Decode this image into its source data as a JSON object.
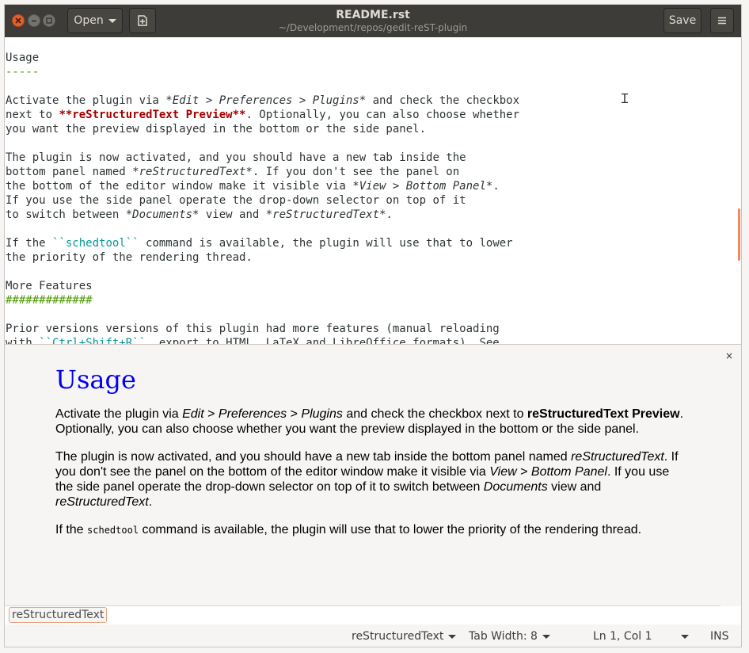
{
  "header": {
    "title": "README.rst",
    "subtitle": "~/Development/repos/gedit-reST-plugin",
    "open_label": "Open",
    "save_label": "Save"
  },
  "editor": {
    "lines": [
      [
        {
          "t": "Usage"
        }
      ],
      [
        {
          "t": "-----",
          "c": "ul"
        }
      ],
      [
        {
          "t": ""
        }
      ],
      [
        {
          "t": "Activate the plugin via "
        },
        {
          "t": "*Edit > Preferences > Plugins*",
          "c": "em"
        },
        {
          "t": " and check the checkbox"
        }
      ],
      [
        {
          "t": "next to "
        },
        {
          "t": "**reStructuredText Preview**",
          "c": "bold"
        },
        {
          "t": ". Optionally, you can also choose whether"
        }
      ],
      [
        {
          "t": "you want the preview displayed in the bottom or the side panel."
        }
      ],
      [
        {
          "t": ""
        }
      ],
      [
        {
          "t": "The plugin is now activated, and you should have a new tab inside the"
        }
      ],
      [
        {
          "t": "bottom panel named "
        },
        {
          "t": "*reStructuredText*",
          "c": "em"
        },
        {
          "t": ". If you don't see the panel on"
        }
      ],
      [
        {
          "t": "the bottom of the editor window make it visible via "
        },
        {
          "t": "*View > Bottom Panel*",
          "c": "em"
        },
        {
          "t": "."
        }
      ],
      [
        {
          "t": "If you use the side panel operate the drop-down selector on top of it"
        }
      ],
      [
        {
          "t": "to switch between "
        },
        {
          "t": "*Documents*",
          "c": "em"
        },
        {
          "t": " view and "
        },
        {
          "t": "*reStructuredText*",
          "c": "em"
        },
        {
          "t": "."
        }
      ],
      [
        {
          "t": ""
        }
      ],
      [
        {
          "t": "If the "
        },
        {
          "t": "``schedtool``",
          "c": "lit"
        },
        {
          "t": " command is available, the plugin will use that to lower"
        }
      ],
      [
        {
          "t": "the priority of the rendering thread."
        }
      ],
      [
        {
          "t": ""
        }
      ],
      [
        {
          "t": "More Features"
        }
      ],
      [
        {
          "t": "#############",
          "c": "ul"
        }
      ],
      [
        {
          "t": ""
        }
      ],
      [
        {
          "t": "Prior versions versions of this plugin had more features (manual reloading"
        }
      ],
      [
        {
          "t": "with "
        },
        {
          "t": "``Ctrl+Shift+R``",
          "c": "lit"
        },
        {
          "t": ", export to HTML, LaTeX and LibreOffice formats). See"
        }
      ]
    ]
  },
  "preview": {
    "heading": "Usage",
    "paragraphs": [
      [
        {
          "t": "Activate the plugin via "
        },
        {
          "t": "Edit",
          "s": "i"
        },
        {
          "t": " > "
        },
        {
          "t": "Preferences",
          "s": "i"
        },
        {
          "t": " > "
        },
        {
          "t": "Plugins",
          "s": "i"
        },
        {
          "t": " and check the checkbox next to "
        },
        {
          "t": "reStructuredText Preview",
          "s": "b"
        },
        {
          "t": ". Optionally, you can also choose whether you want the preview displayed in the bottom or the side panel."
        }
      ],
      [
        {
          "t": "The plugin is now activated, and you should have a new tab inside the bottom panel named "
        },
        {
          "t": "reStructuredText",
          "s": "i"
        },
        {
          "t": ". If you don't see the panel on the bottom of the editor window make it visible via "
        },
        {
          "t": "View",
          "s": "i"
        },
        {
          "t": " > "
        },
        {
          "t": "Bottom Panel",
          "s": "i"
        },
        {
          "t": ". If you use the side panel operate the drop-down selector on top of it to switch between "
        },
        {
          "t": "Documents",
          "s": "i"
        },
        {
          "t": " view and "
        },
        {
          "t": "reStructuredText",
          "s": "i"
        },
        {
          "t": "."
        }
      ],
      [
        {
          "t": "If the "
        },
        {
          "t": "schedtool",
          "s": "tt"
        },
        {
          "t": " command is available, the plugin will use that to lower the priority of the rendering thread."
        }
      ]
    ],
    "close_glyph": "×"
  },
  "bottom_panel": {
    "tab_label": "reStructuredText"
  },
  "statusbar": {
    "language": "reStructuredText",
    "tab_width": "Tab Width: 8",
    "position": "Ln 1, Col 1",
    "mode": "INS"
  },
  "colors": {
    "accent": "#e0602f",
    "header_bg": "#3d3c38",
    "link_heading": "#0000ee",
    "rst_bold": "#a40000",
    "rst_literal": "#06989a",
    "rst_underline": "#4e9a06"
  }
}
